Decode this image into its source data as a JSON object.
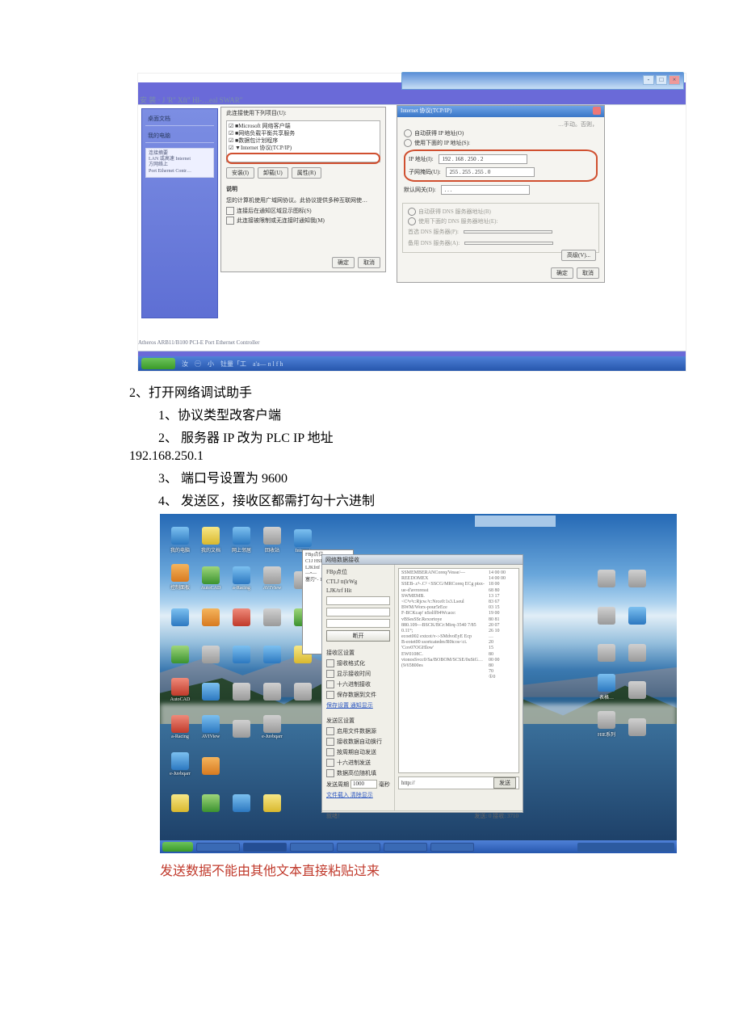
{
  "shot1": {
    "toplabel": "安 装 ·   J 'R\" Xft\" Hl-…eal SWAR\"",
    "tasklabels": [
      "汝",
      "小",
      "钍量「工",
      "a'a— n l f h"
    ],
    "sidebar": {
      "items": [
        "桌面文档",
        "我的电脑"
      ],
      "bottom": {
        "t": "连接摘要",
        "a": "LAN 或高速 Internet",
        "b": "方网络上",
        "c": "Port Ethernet Contr…"
      }
    },
    "dlg1": {
      "headline": "此连接使用下列项目(U):",
      "items": [
        "☑ ■Microsoft 网络客户端",
        "☑ ■网络负载平衡共享服务",
        "☑ ■数据包计划程序",
        "☑ ▼Internet 协议(TCP/IP)"
      ],
      "btn_install": "安装(I)",
      "btn_uninstall": "卸载(U)",
      "btn_prop": "属性(R)",
      "desc_t": "说明",
      "desc": "您的计算机使用广域网协议。此协议提供多种互联网使…",
      "chk1": "连接后在通知区域显示图标(S)",
      "chk2": "此连接被限制或无连接时通知我(M)",
      "ok": "确定",
      "cancel": "取消"
    },
    "dlg2": {
      "title": "Internet 协议(TCP/IP)",
      "note": "…手动。否则，",
      "r1": "自动获得 IP 地址(O)",
      "r2": "使用下面的 IP 地址(S):",
      "ip_l": "IP 地址(I):",
      "ip_v": "192 . 168 . 250 .  2",
      "mask_l": "子网掩码(U):",
      "mask_v": "255 . 255 . 255 .  0",
      "gw_l": "默认网关(D):",
      "gw_v": " .  .  . ",
      "r3": "自动获得 DNS 服务器地址(B)",
      "r4": "使用下面的 DNS 服务器地址(E):",
      "dns1_l": "首选 DNS 服务器(P):",
      "dns2_l": "备用 DNS 服务器(A):",
      "adv": "高级(V)...",
      "ok": "确定",
      "cancel": "取消"
    },
    "bottom_text": "Atheros ARB11/B100 PCI-E Port Ethernet Controller"
  },
  "text": {
    "h2": "2、打开网络调试助手",
    "l1": "1、协议类型改客户端",
    "l2": "2、  服务器  IP 改为  PLC IP 地址",
    "ip": "192.168.250.1",
    "l3": "3、  端口号设置为  9600",
    "l4": "4、  发送区，接收区都需打勾十六进制",
    "warn": "发送数据不能由其他文本直接粘贴过来"
  },
  "shot2": {
    "tool": {
      "title": "网络数据接收",
      "side": {
        "hdr": "FBp点位",
        "a": "CTLJ tt(lrWg",
        "b": "LJK/trf Hit",
        "btn_conn": "断开",
        "grp_rx": "接收区设置",
        "ck1": "接收格式化",
        "ck2": "显示接收时间",
        "ck3": "十六进制接收",
        "ck4": "保存数据到文件",
        "lk1": "保存设置 通知显示",
        "grp_tx": "发送区设置",
        "ck5": "启用文件数据源",
        "ck6": "接收数据自动换行",
        "ck7": "按周期自动发送",
        "ck8": "十六进制发送",
        "ck9": "数据高位随机填",
        "period_l": "发送周期",
        "period_v": "1000",
        "period_u": "毫秒",
        "lk2": "文件载入 清除显示"
      },
      "hex_rows": [
        "14 00 00",
        "14 00 00",
        "18 00",
        "68 80",
        "13 17",
        "83 67",
        "03 15",
        "19 00",
        "80 81",
        "20 07",
        "26 10",
        "…",
        "20",
        "15",
        "80",
        "00 00",
        "80",
        "70",
        "①0"
      ],
      "send_placeholder": "http://",
      "send_btn": "发送",
      "bot_l": "就绪！",
      "bot_r": "发送: 0    接收: 3710"
    },
    "note": {
      "lines": [
        "FBp点位",
        "C1J  HSIrWg",
        "",
        "LJKfrtf Hit",
        "",
        "—•—",
        "",
        "塞刃\"-  191•税"
      ]
    },
    "desktop_labels": [
      "我的电脑",
      "我的文档",
      "网上邻居",
      "回收站",
      "Internet",
      "控制面板",
      "AutoCAD",
      "a-Racing",
      "AVIView",
      "e-Juvbqarr",
      "表格…",
      "HIE系列"
    ]
  }
}
